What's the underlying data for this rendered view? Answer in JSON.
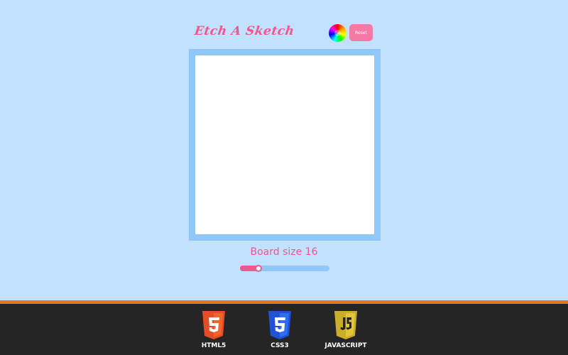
{
  "header": {
    "title": "Etch A Sketch",
    "color_picker_icon": "color-wheel-icon",
    "reset_label": "Reset"
  },
  "board": {
    "background": "#ffffff",
    "frame_color": "#90c7f9"
  },
  "board_size": {
    "label": "Board size 16",
    "value": 16,
    "min": 1,
    "max": 100
  },
  "footer": {
    "accent_color": "#e0771d",
    "technologies": [
      {
        "label": "HTML5",
        "icon": "html5-icon",
        "color": "#e44d26"
      },
      {
        "label": "CSS3",
        "icon": "css3-icon",
        "color": "#1572b6"
      },
      {
        "label": "JAVASCRIPT",
        "icon": "javascript-icon",
        "color": "#d6ba32"
      }
    ]
  },
  "colors": {
    "background": "#c2e1fd",
    "accent_pink": "#f0578f"
  }
}
